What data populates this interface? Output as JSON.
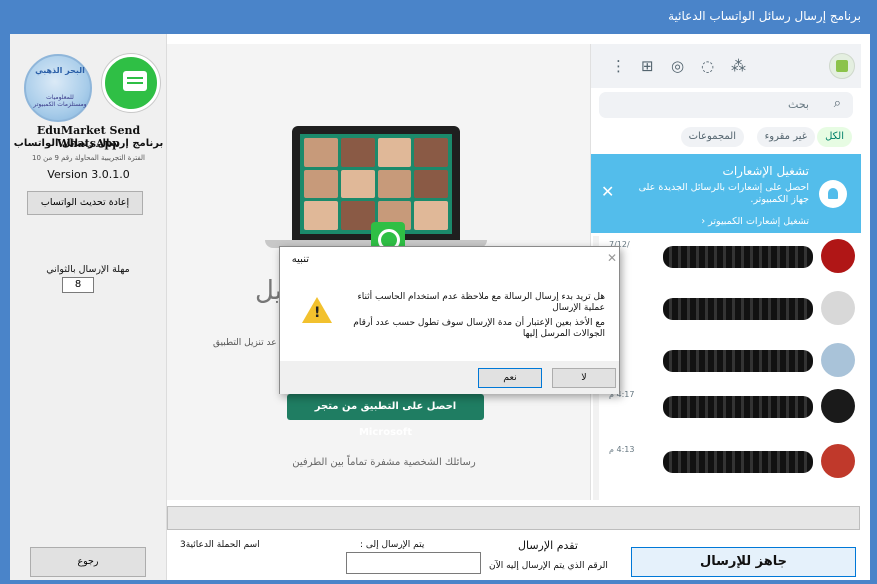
{
  "window": {
    "title": "برنامج إرسال رسائل الواتساب الدعائية"
  },
  "left_panel": {
    "logo_text_1": "البحر الذهبي",
    "logo_text_2": "للمعلوميات ومستلزمات الكمبيوتر",
    "app_name_en": "EduMarket Send WhatsApp",
    "app_name_ar": "برنامج إرسال رسائل الواتساب",
    "trial_text": "الفترة التجريبية المحاولة رقم 9 من 10",
    "version": "Version 3.0.1.0",
    "reload_button": "إعادة تحديث الواتساب",
    "delay_label": "مهلة الإرسال بالثواني",
    "delay_value": "8",
    "back_button": "رجوع"
  },
  "center": {
    "big_text": "شغيل",
    "side_text": "عد تنزيل التطبيق",
    "store_button": "احصل على التطبيق من متجر Microsoft",
    "encrypted_text": "رسائلك الشخصية مشفرة تماماً بين الطرفين"
  },
  "whatsapp": {
    "search_placeholder": "بحث",
    "chips": [
      "الكل",
      "غير مقروء",
      "المجموعات"
    ],
    "notification": {
      "title": "تشغيل الإشعارات",
      "body": "احصل على إشعارات بالرسائل الجديدة على جهاز الكمبيوتر.",
      "link": "تشغيل إشعارات الكمبيوتر ‹"
    },
    "chat_times": [
      "/7/12",
      "",
      "",
      "4:17 م",
      "4:13 م"
    ]
  },
  "bottom": {
    "progress_label": "تقدم الإرسال",
    "sending_to_label": "يتم الإرسال إلى :",
    "campaign_label": "اسم الحملة الدعائية3",
    "current_number_label": "الرقم الذي يتم الإرسال إليه الآن",
    "ready_button": "جاهز للإرسال"
  },
  "dialog": {
    "title": "تنبيه",
    "message_line1": "هل تريد بدء إرسال الرسالة مع ملاحظة عدم استخدام الحاسب أثناء عملية الإرسال",
    "message_line2": "مع الأخذ بعين الإعتبار أن مدة الإرسال سوف تطول حسب عدد أرقام الجوالات المرسل إليها",
    "yes_button": "نعم",
    "no_button": "لا"
  },
  "colors": {
    "titlebar": "#4a84c9",
    "whatsapp_green": "#2fbf45",
    "notification_blue": "#53bdeb",
    "store_button": "#1f7d62"
  }
}
